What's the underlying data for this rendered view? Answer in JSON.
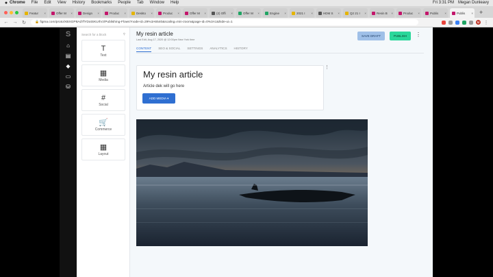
{
  "menubar": {
    "apple": "",
    "app": "Chrome",
    "items": [
      "File",
      "Edit",
      "View",
      "History",
      "Bookmarks",
      "People",
      "Tab",
      "Window",
      "Help"
    ],
    "clock": "Fri 3:31 PM",
    "user": "Megan Dunleavy"
  },
  "tabs": [
    {
      "label": "Featur",
      "color": "#e5b400"
    },
    {
      "label": "Offer M",
      "color": "#c3166b"
    },
    {
      "label": "Design",
      "color": "#c3166b"
    },
    {
      "label": "Produc",
      "color": "#c3166b"
    },
    {
      "label": "Deskto",
      "color": "#e5b400"
    },
    {
      "label": "Produc",
      "color": "#c3166b"
    },
    {
      "label": "Offer M",
      "color": "#c3166b"
    },
    {
      "label": "(2) Offi",
      "color": "#555555"
    },
    {
      "label": "Offer M",
      "color": "#1fa463"
    },
    {
      "label": "Engine",
      "color": "#1fa463"
    },
    {
      "label": "2021 I",
      "color": "#e5b400"
    },
    {
      "label": "HDM S",
      "color": "#555555"
    },
    {
      "label": "Q2 21 I",
      "color": "#e5b400"
    },
    {
      "label": "Resin B",
      "color": "#c3166b"
    },
    {
      "label": "Produc",
      "color": "#c3166b"
    },
    {
      "label": "Publis",
      "color": "#c3166b"
    },
    {
      "label": "Publis",
      "color": "#c3166b",
      "active": true
    }
  ],
  "address": {
    "url": "figma.com/proto/XBXGP8Ad7fYDotSKUrlVz/Publishing-Flows?node-id=29%3A6540&scaling=min-zoom&page-id=0%3A1&hide-ui=1"
  },
  "rail": {
    "logo": "S"
  },
  "blocks": {
    "search_placeholder": "Search for a block",
    "items": [
      {
        "label": "Text",
        "icon": "text-icon",
        "glyph": "T"
      },
      {
        "label": "Media",
        "icon": "film-icon",
        "glyph": "▦"
      },
      {
        "label": "Social",
        "icon": "hash-icon",
        "glyph": "#"
      },
      {
        "label": "Commerce",
        "icon": "cart-icon",
        "glyph": "🛒"
      },
      {
        "label": "Layout",
        "icon": "grid-icon",
        "glyph": "▦"
      }
    ]
  },
  "editor": {
    "title": "My resin article",
    "last_edit": "Last Edit, Aug 17, 2020 @ 12:00pm New York time",
    "save_draft": "SAVE DRAFT",
    "publish": "PUBLISH",
    "tabs": [
      "CONTENT",
      "SEO & SOCIAL",
      "SETTINGS",
      "ANALYTICS",
      "HISTORY"
    ],
    "active_tab": 0,
    "article_title": "My resin article",
    "article_dek": "Article dek will go here",
    "add_media": "ADD MEDIA"
  },
  "colors": {
    "primary": "#2f6fd1",
    "publish": "#2bd79b",
    "save_draft": "#9fc0e8"
  }
}
